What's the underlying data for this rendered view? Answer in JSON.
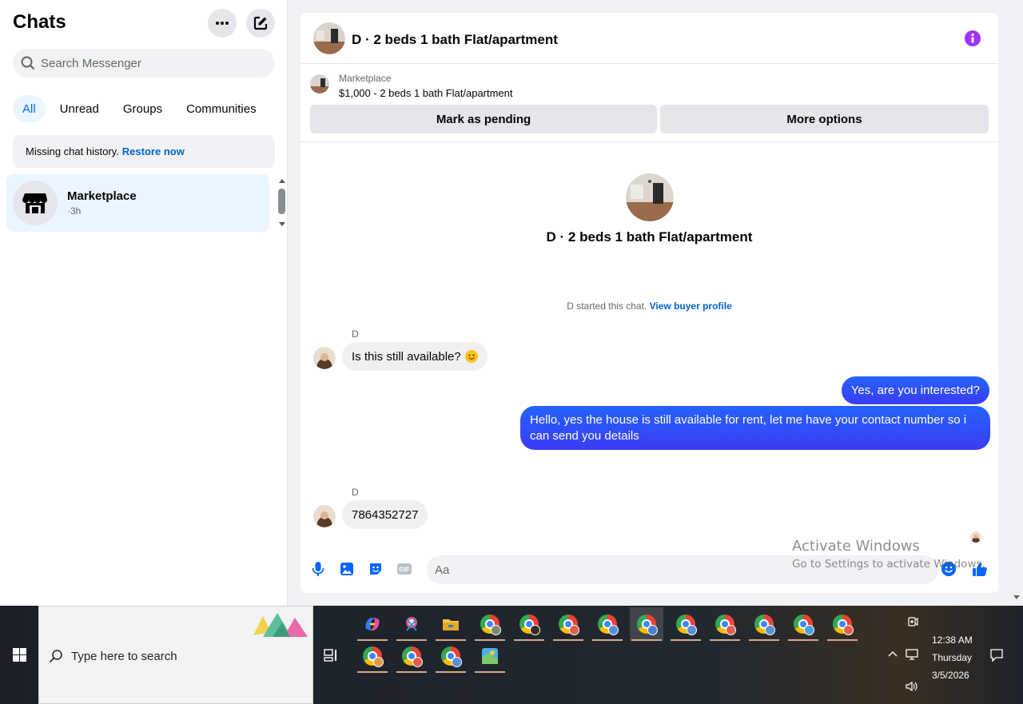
{
  "sidebar": {
    "title": "Chats",
    "search_placeholder": "Search Messenger",
    "tabs": [
      "All",
      "Unread",
      "Groups",
      "Communities"
    ],
    "notice_text": "Missing chat history.",
    "notice_link": "Restore now",
    "chats": [
      {
        "name": "Marketplace",
        "time": "·3h"
      }
    ]
  },
  "conversation": {
    "title": "D · 2 beds 1 bath Flat/apartment",
    "listing": {
      "source": "Marketplace",
      "title": "$1,000 - 2 beds 1 bath Flat/apartment",
      "btn_pending": "Mark as pending",
      "btn_more": "More options"
    },
    "intro_title": "D · 2 beds 1 bath Flat/apartment",
    "started_text": "D started this chat.",
    "started_link": "View buyer profile",
    "messages": [
      {
        "sender": "D",
        "text": "Is this still available?"
      },
      {
        "text": "Yes, are you interested?"
      },
      {
        "text": "Hello, yes the house is still available for rent, let me have your contact number so i can send you details"
      },
      {
        "sender": "D",
        "text": "7864352727"
      }
    ],
    "composer_placeholder": "Aa"
  },
  "watermark": {
    "line1": "Activate Windows",
    "line2": "Go to Settings to activate Windows."
  },
  "taskbar": {
    "search_placeholder": "Type here to search",
    "time": "12:38 AM",
    "day": "Thursday",
    "date": "3/5/2026"
  },
  "colors": {
    "accent": "#0866ff",
    "outgoing_bubble": "#2f52f8",
    "info_icon": "#a033ff"
  }
}
